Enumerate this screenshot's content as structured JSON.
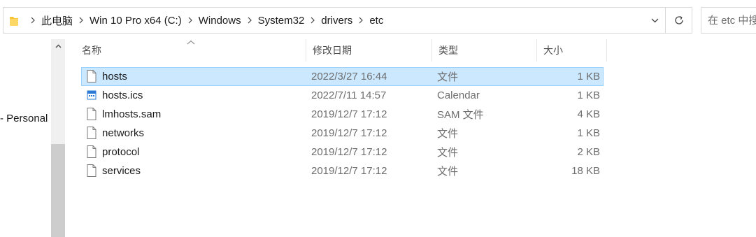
{
  "address_bar": {
    "folder_icon": "folder-icon",
    "breadcrumb": [
      "此电脑",
      "Win 10 Pro x64 (C:)",
      "Windows",
      "System32",
      "drivers",
      "etc"
    ],
    "separator_icon": "chevron-right-icon",
    "dropdown_icon": "chevron-down-icon",
    "refresh_icon": "refresh-icon"
  },
  "search": {
    "placeholder": "在 etc 中搜索"
  },
  "nav_pane": {
    "visible_item": "- Personal"
  },
  "file_list": {
    "columns": [
      "名称",
      "修改日期",
      "类型",
      "大小"
    ],
    "sort_column": "名称",
    "sort_icon": "sort-up-icon",
    "rows": [
      {
        "name": "hosts",
        "modified": "2022/3/27 16:44",
        "type": "文件",
        "size": "1 KB",
        "icon": "blank-file-icon",
        "selected": true
      },
      {
        "name": "hosts.ics",
        "modified": "2022/7/11 14:57",
        "type": "Calendar",
        "size": "1 KB",
        "icon": "calendar-file-icon",
        "selected": false
      },
      {
        "name": "lmhosts.sam",
        "modified": "2019/12/7 17:12",
        "type": "SAM 文件",
        "size": "4 KB",
        "icon": "blank-file-icon",
        "selected": false
      },
      {
        "name": "networks",
        "modified": "2019/12/7 17:12",
        "type": "文件",
        "size": "1 KB",
        "icon": "blank-file-icon",
        "selected": false
      },
      {
        "name": "protocol",
        "modified": "2019/12/7 17:12",
        "type": "文件",
        "size": "2 KB",
        "icon": "blank-file-icon",
        "selected": false
      },
      {
        "name": "services",
        "modified": "2019/12/7 17:12",
        "type": "文件",
        "size": "18 KB",
        "icon": "blank-file-icon",
        "selected": false
      }
    ]
  },
  "colors": {
    "selection_background": "#cce8ff",
    "selection_border": "#99d1ff",
    "folder_yellow": "#f8c537",
    "secondary_text": "#6d6d6d"
  }
}
